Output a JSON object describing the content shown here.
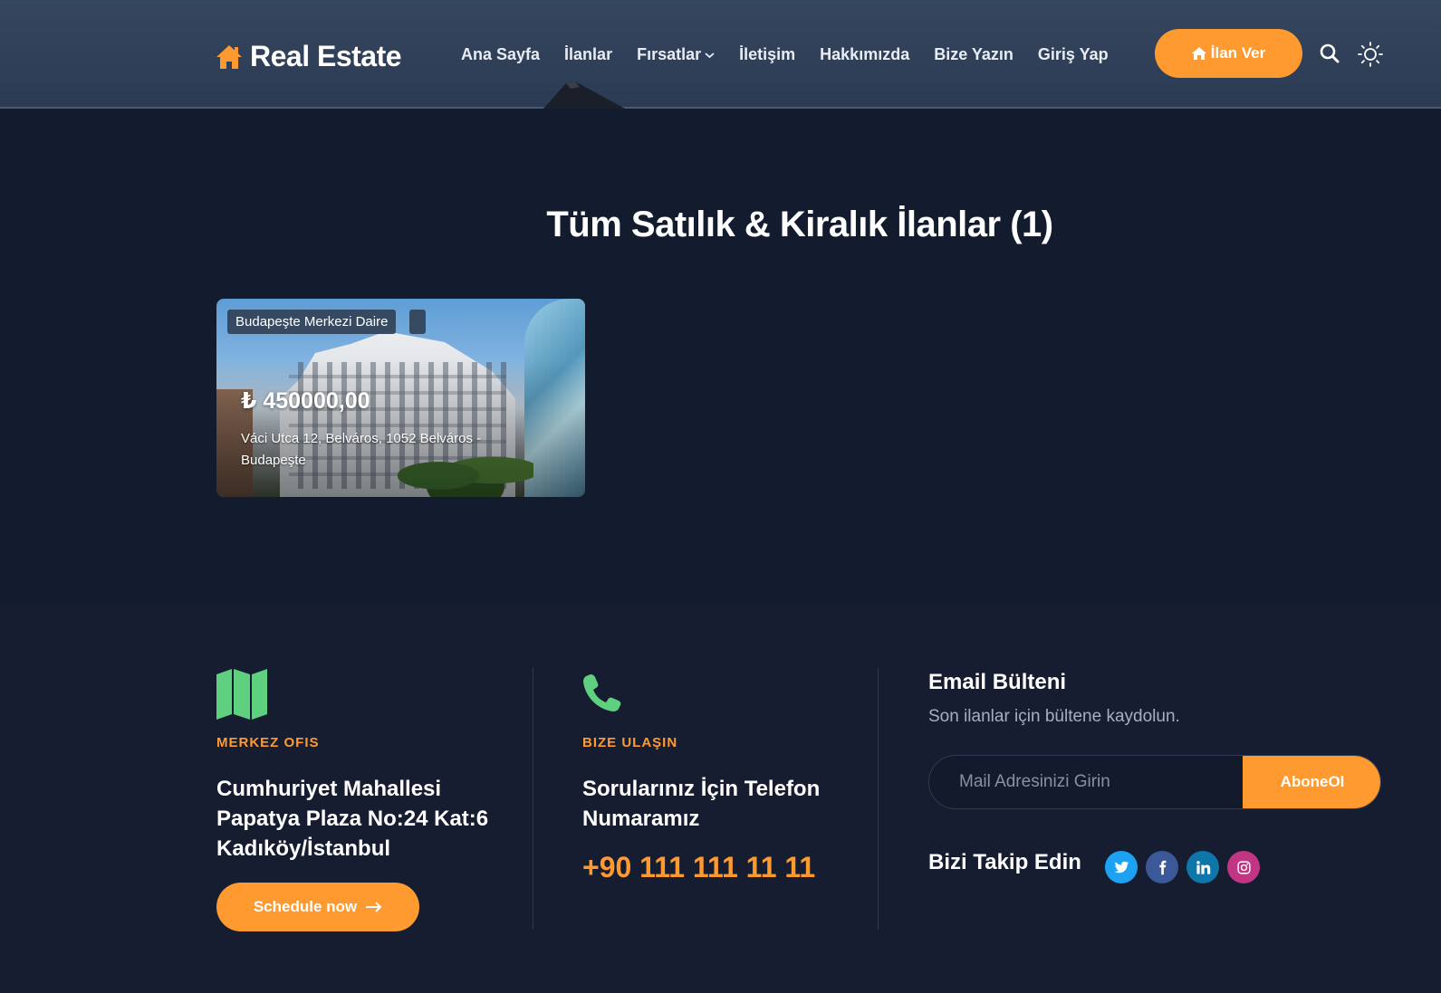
{
  "header": {
    "logo_text": "Real Estate",
    "nav": [
      {
        "label": "Ana Sayfa"
      },
      {
        "label": "İlanlar"
      },
      {
        "label": "Fırsatlar"
      },
      {
        "label": "İletişim"
      },
      {
        "label": "Hakkımızda"
      },
      {
        "label": "Bize Yazın"
      },
      {
        "label": "Giriş Yap"
      }
    ],
    "cta_label": "İlan Ver"
  },
  "main": {
    "title": "Tüm Satılık & Kiralık İlanlar (1)",
    "listings": [
      {
        "badge": "Budapeşte Merkezi Daire",
        "price": "₺ 450000,00",
        "address": "Váci Utca 12, Belváros, 1052 Belváros - Budapeşte"
      }
    ]
  },
  "footer": {
    "office": {
      "icon": "map-icon",
      "label": "MERKEZ OFIS",
      "address_lines": [
        "Cumhuriyet Mahallesi",
        "Papatya Plaza No:24 Kat:6",
        "Kadıköy/İstanbul"
      ],
      "button_label": "Schedule now"
    },
    "contact": {
      "icon": "phone-icon",
      "label": "BIZE ULAŞIN",
      "text_lines": [
        "Sorularınız İçin Telefon",
        "Numaramız"
      ],
      "phone": "+90 111 111 11 11"
    },
    "newsletter": {
      "title": "Email Bülteni",
      "subtitle": "Son ilanlar için bültene kaydolun.",
      "placeholder": "Mail Adresinizi Girin",
      "button_label": "AboneOl"
    },
    "follow": {
      "title": "Bizi Takip Edin",
      "networks": [
        {
          "icon": "twitter-icon",
          "color": "#1da1f2"
        },
        {
          "icon": "facebook-icon",
          "color": "#3b5998"
        },
        {
          "icon": "linkedin-icon",
          "color": "#0e76a8"
        },
        {
          "icon": "instagram-icon",
          "color": "#c13584"
        }
      ]
    }
  },
  "colors": {
    "accent": "#ff9a30",
    "background": "#131b2e",
    "header": "#2c3b54",
    "icon_green": "#5fcf80"
  }
}
